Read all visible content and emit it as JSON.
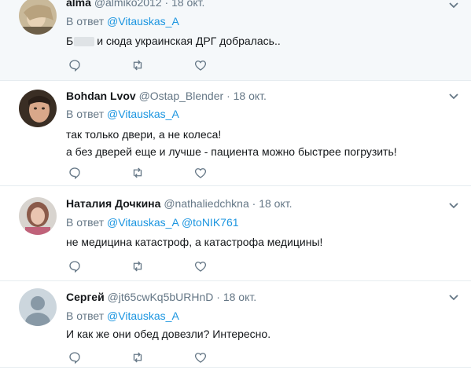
{
  "tweets": [
    {
      "name": "alma",
      "handle": "@almiko2012",
      "date": "18 окт.",
      "reply_prefix": "В ответ",
      "mentions": [
        "@Vitauskas_A"
      ],
      "lines": [
        "Б",
        "и сюда украинская ДРГ добралась.."
      ]
    },
    {
      "name": "Bohdan Lvov",
      "handle": "@Ostap_Blender",
      "date": "18 окт.",
      "reply_prefix": "В ответ",
      "mentions": [
        "@Vitauskas_A"
      ],
      "lines": [
        "так только двери, а не колеса!",
        "а без дверей еще и лучше - пациента можно быстрее погрузить!"
      ]
    },
    {
      "name": "Наталия Дочкина",
      "handle": "@nathaliedchkna",
      "date": "18 окт.",
      "reply_prefix": "В ответ",
      "mentions": [
        "@Vitauskas_A",
        "@toNIK761"
      ],
      "lines": [
        "не медицина катастроф, а катастрофа медицины!"
      ]
    },
    {
      "name": "Сергей",
      "handle": "@jt65cwKq5bURHnD",
      "date": "18 окт.",
      "reply_prefix": "В ответ",
      "mentions": [
        "@Vitauskas_A"
      ],
      "lines": [
        "И как же они обед довезли? Интересно."
      ]
    }
  ],
  "icons": {
    "reply": "reply-icon",
    "retweet": "retweet-icon",
    "like": "heart-icon",
    "menu": "chevron-down-icon"
  },
  "colors": {
    "link": "#1b95e0",
    "secondary": "#657786",
    "highlight_bg": "#f5f8fa"
  },
  "separator": "·"
}
